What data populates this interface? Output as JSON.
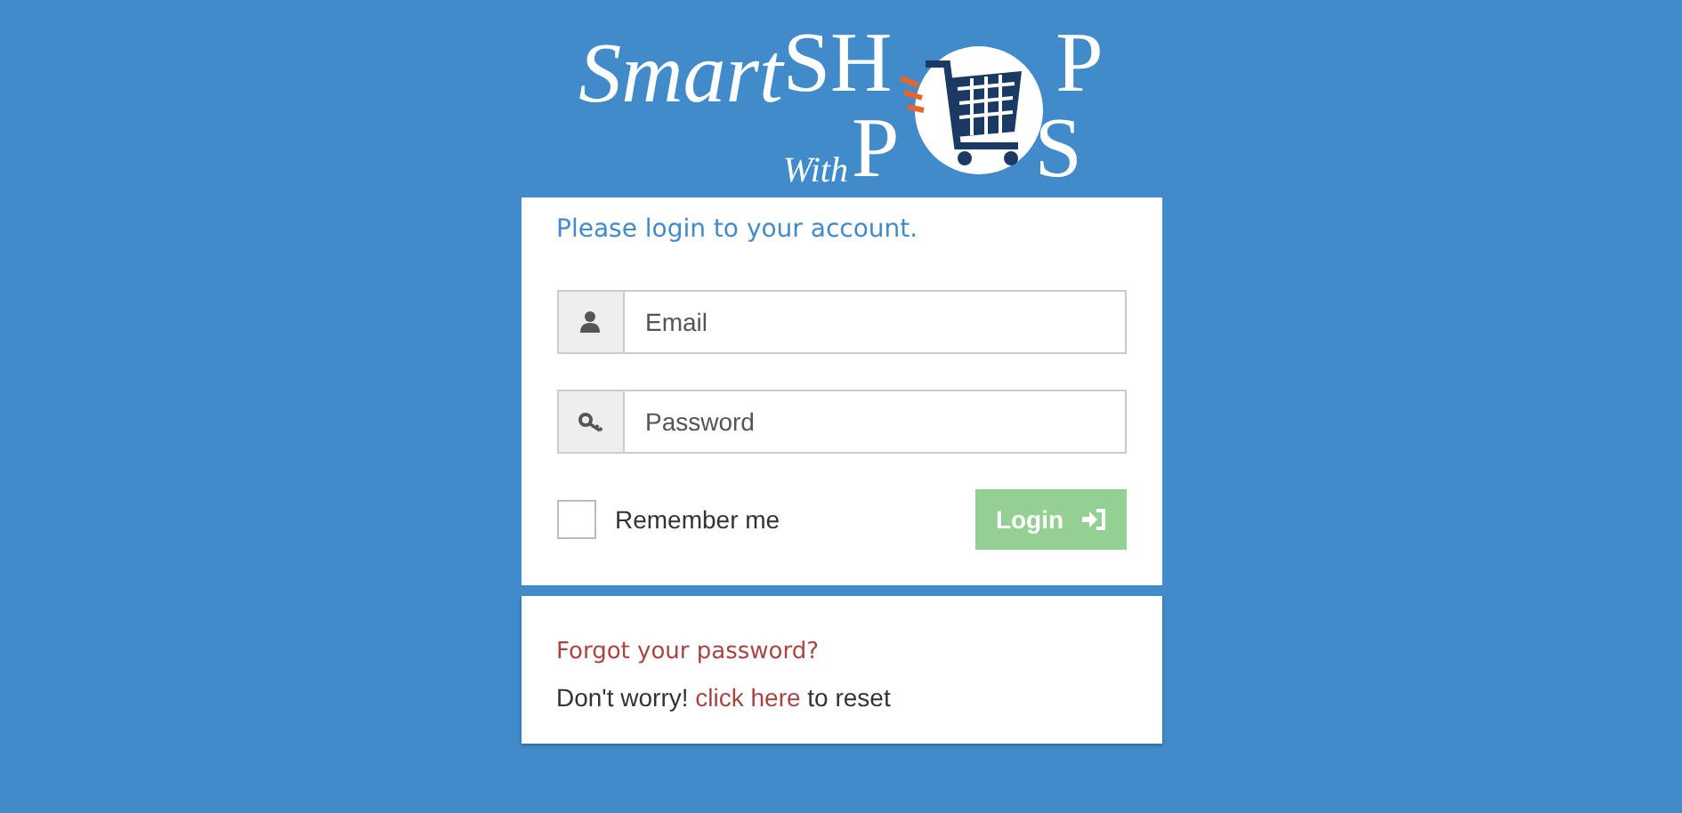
{
  "logo": {
    "smart": "Smart",
    "shop_start": "SH",
    "shop_end": "P",
    "with": "With",
    "pos_start": "P",
    "pos_end": "S"
  },
  "login": {
    "heading": "Please login to your account.",
    "fields": [
      {
        "kind": "email",
        "placeholder": "Email"
      },
      {
        "kind": "password",
        "placeholder": "Password"
      }
    ],
    "remember": {
      "label": "Remember me",
      "checked": false
    },
    "button": {
      "label": "Login",
      "disabled": true
    }
  },
  "forgot": {
    "title": "Forgot your password?",
    "before": "Don't worry!",
    "link": "click here",
    "after": "to reset"
  }
}
